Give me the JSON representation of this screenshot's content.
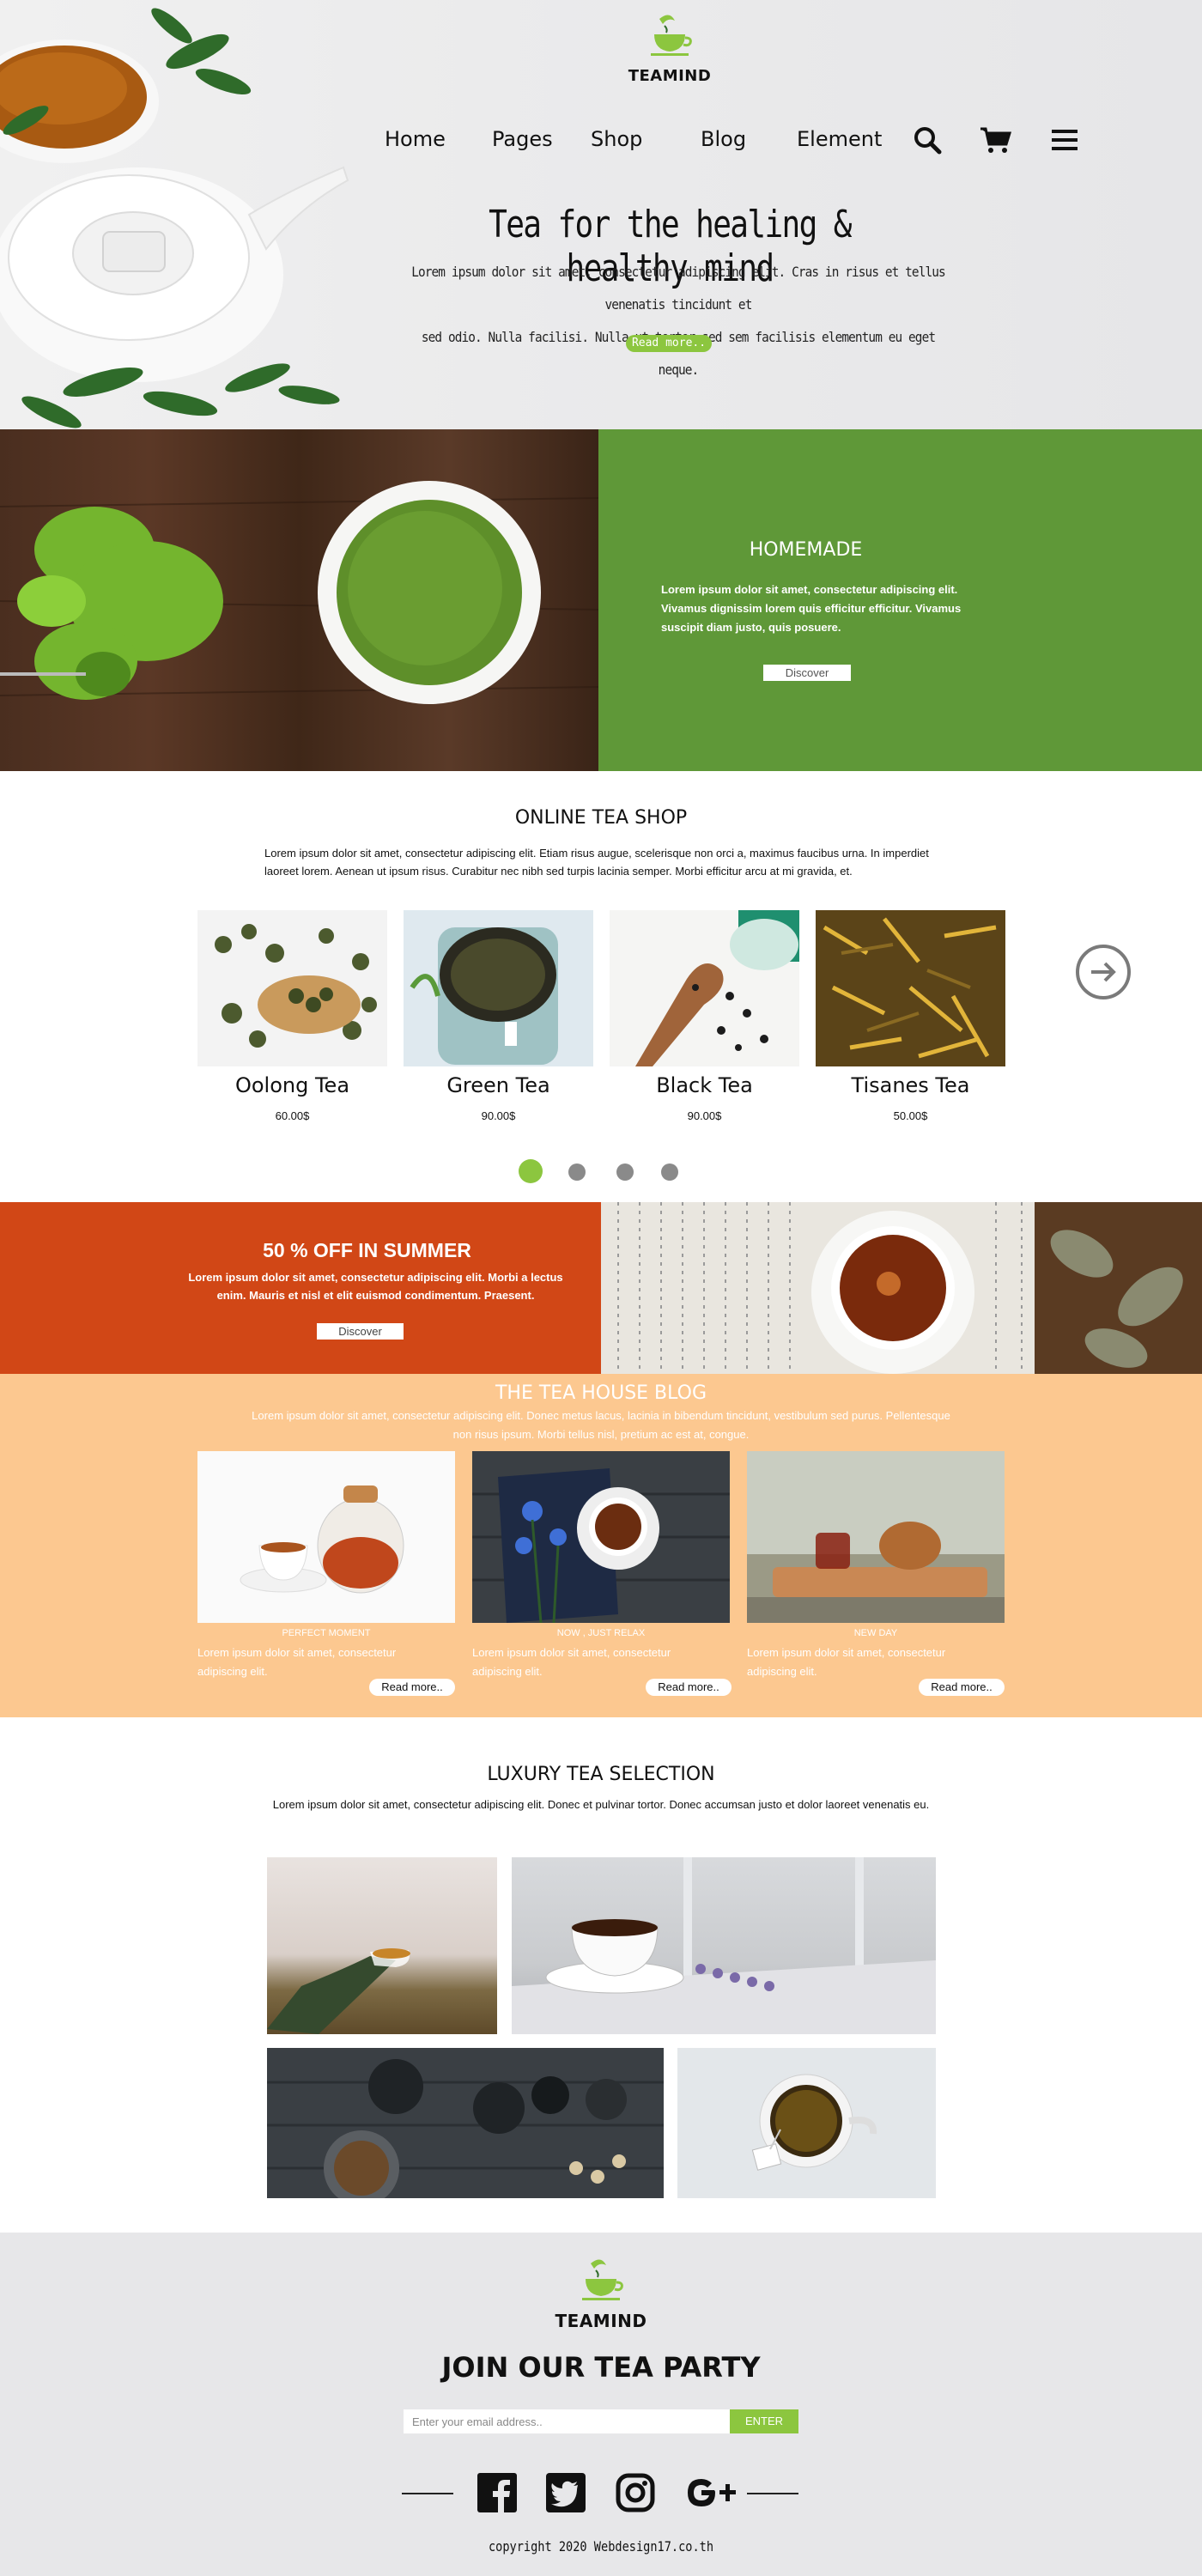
{
  "brand": {
    "name": "TEAMIND"
  },
  "nav": {
    "items": [
      "Home",
      "Pages",
      "Shop",
      "Blog",
      "Element"
    ],
    "icons": [
      "search-icon",
      "cart-icon",
      "menu-icon"
    ]
  },
  "hero": {
    "title": "Tea for the healing & healthy mind",
    "body_line1": "Lorem ipsum dolor sit amet, consectetur adipiscing elit. Cras in risus et tellus venenatis tincidunt et",
    "body_line2": "sed odio. Nulla facilisi. Nulla ut tortor sed sem facilisis elementum eu eget neque.",
    "button": "Read more.."
  },
  "homemade": {
    "title": "HOMEMADE",
    "body": "Lorem ipsum dolor sit amet, consectetur adipiscing elit. Vivamus dignissim lorem quis efficitur efficitur. Vivamus suscipit diam justo, quis posuere.",
    "button": "Discover"
  },
  "shop": {
    "title": "ONLINE TEA SHOP",
    "body": "Lorem ipsum dolor sit amet, consectetur adipiscing elit. Etiam risus augue, scelerisque non orci a, maximus faucibus urna. In imperdiet laoreet lorem. Aenean ut ipsum risus. Curabitur nec nibh sed turpis lacinia semper. Morbi efficitur arcu at mi gravida, et.",
    "products": [
      {
        "name": "Oolong Tea",
        "price": "60.00$"
      },
      {
        "name": "Green Tea",
        "price": "90.00$"
      },
      {
        "name": "Black Tea",
        "price": "90.00$"
      },
      {
        "name": "Tisanes Tea",
        "price": "50.00$"
      }
    ],
    "active_dot": 0,
    "dot_count": 4
  },
  "summer": {
    "title": "50 % OFF IN SUMMER",
    "body": "Lorem ipsum dolor sit amet, consectetur adipiscing elit. Morbi a lectus enim. Mauris et nisl et elit euismod condimentum. Praesent.",
    "button": "Discover"
  },
  "blog": {
    "title": "THE TEA HOUSE  BLOG",
    "body": "Lorem ipsum dolor sit amet, consectetur adipiscing elit. Donec metus lacus, lacinia in bibendum tincidunt, vestibulum sed purus. Pellentesque non risus ipsum. Morbi tellus nisl, pretium ac est at, congue.",
    "posts": [
      {
        "caption": "PERFECT MOMENT",
        "text": "Lorem ipsum dolor sit amet, consectetur adipiscing elit.",
        "button": "Read more.."
      },
      {
        "caption": "NOW , JUST RELAX",
        "text": "Lorem ipsum dolor sit amet, consectetur adipiscing elit.",
        "button": "Read more.."
      },
      {
        "caption": "NEW DAY",
        "text": "Lorem ipsum dolor sit amet, consectetur adipiscing elit.",
        "button": "Read more.."
      }
    ]
  },
  "luxury": {
    "title": "LUXURY TEA SELECTION",
    "body": "Lorem ipsum dolor sit amet, consectetur adipiscing elit. Donec et pulvinar tortor. Donec accumsan justo et dolor laoreet venenatis eu."
  },
  "footer": {
    "join_title": "JOIN OUR TEA PARTY",
    "email_placeholder": "Enter your email address..",
    "enter_button": "ENTER",
    "social": [
      "facebook-icon",
      "twitter-icon",
      "instagram-icon",
      "google-plus-icon"
    ],
    "copyright": "copyright 2020 Webdesign17.co.th"
  },
  "colors": {
    "accent_green": "#8cc63f",
    "homemade_green": "#5f9838",
    "summer_orange": "#d14716",
    "blog_peach": "#fcc890",
    "footer_gray": "#e7e7e9"
  }
}
